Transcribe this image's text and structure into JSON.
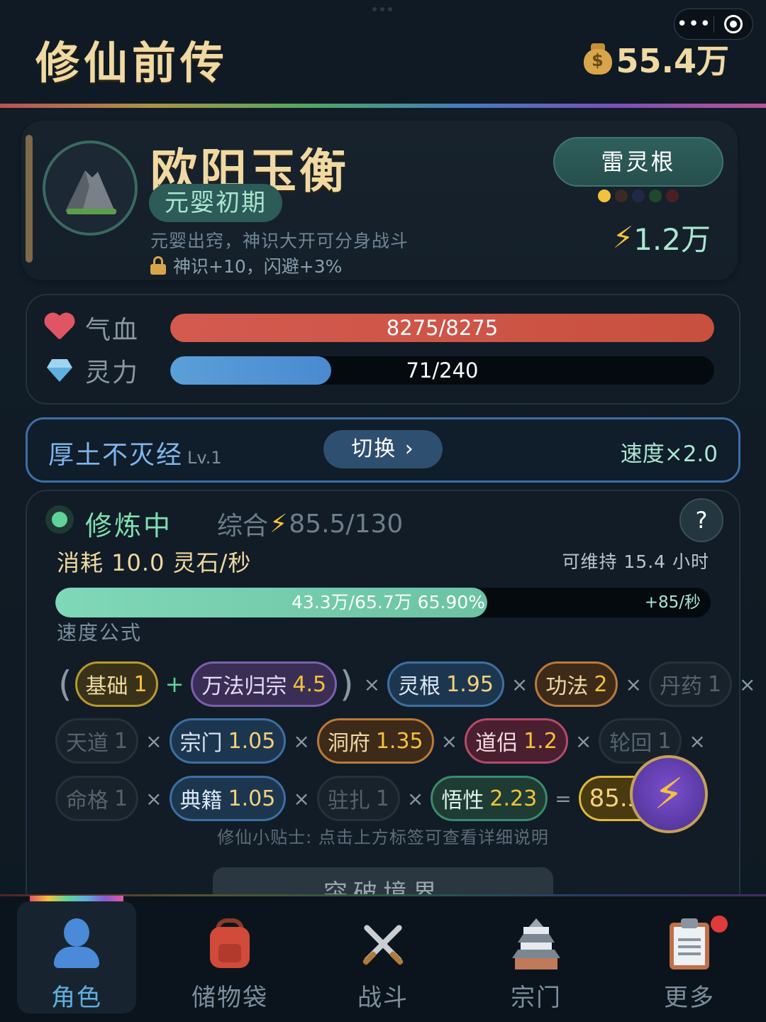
{
  "header": {
    "app_title": "修仙前传",
    "money": "55.4万",
    "money_icon": "money-bag-icon",
    "capsule_more": "•••"
  },
  "character": {
    "name": "欧阳玉衡",
    "realm": "元婴初期",
    "realm_desc": "元婴出窍，神识大开可分身战斗",
    "realm_bonus": "神识+10，闪避+3%",
    "spirit_root": "雷灵根",
    "root_dot_colors": [
      "#f3c23c",
      "#3a2a22",
      "#1f2a48",
      "#1f4a2a",
      "#4a1f24"
    ],
    "power": "1.2万"
  },
  "stats": {
    "hp_label": "气血",
    "hp_value": "8275/8275",
    "hp_fraction": 1.0,
    "mp_label": "灵力",
    "mp_value": "71/240",
    "mp_fraction": 0.296
  },
  "technique": {
    "name": "厚土不灭经",
    "level": "Lv.1",
    "switch_label": "切换 ›",
    "speed": "速度×2.0"
  },
  "cultivation": {
    "status": "修炼中",
    "combined": "综合",
    "combined_value": "85.5/130",
    "help": "?",
    "consume": "消耗 10.0 灵石/秒",
    "sustain": "可维持 15.4 小时",
    "progress_text": "43.3万/65.7万  65.90%",
    "progress_fraction": 0.659,
    "rate": "+85/秒",
    "formula_label": "速度公式",
    "formula": {
      "open_paren": "(",
      "close_paren": ")",
      "plus": "+",
      "times": "×",
      "equals": "=",
      "base": {
        "label": "基础",
        "value": "1"
      },
      "wanfa": {
        "label": "万法归宗",
        "value": "4.5"
      },
      "linggen": {
        "label": "灵根",
        "value": "1.95"
      },
      "gongfa": {
        "label": "功法",
        "value": "2"
      },
      "danyao": {
        "label": "丹药",
        "value": "1"
      },
      "tiandao": {
        "label": "天道",
        "value": "1"
      },
      "zongmen": {
        "label": "宗门",
        "value": "1.05"
      },
      "dongfu": {
        "label": "洞府",
        "value": "1.35"
      },
      "daolv": {
        "label": "道侣",
        "value": "1.2"
      },
      "lunhui": {
        "label": "轮回",
        "value": "1"
      },
      "mingge": {
        "label": "命格",
        "value": "1"
      },
      "dianji": {
        "label": "典籍",
        "value": "1.05"
      },
      "zhuzha": {
        "label": "驻扎",
        "value": "1"
      },
      "wuxing": {
        "label": "悟性",
        "value": "2.23"
      },
      "result": "85.53"
    },
    "tip": "修仙小贴士: 点击上方标签可查看详细说明",
    "break_button": "突破境界"
  },
  "tabbar": {
    "tabs": [
      {
        "label": "角色",
        "icon": "person-icon"
      },
      {
        "label": "储物袋",
        "icon": "backpack-icon"
      },
      {
        "label": "战斗",
        "icon": "crossed-swords-icon"
      },
      {
        "label": "宗门",
        "icon": "castle-icon"
      },
      {
        "label": "更多",
        "icon": "clipboard-icon"
      }
    ]
  }
}
